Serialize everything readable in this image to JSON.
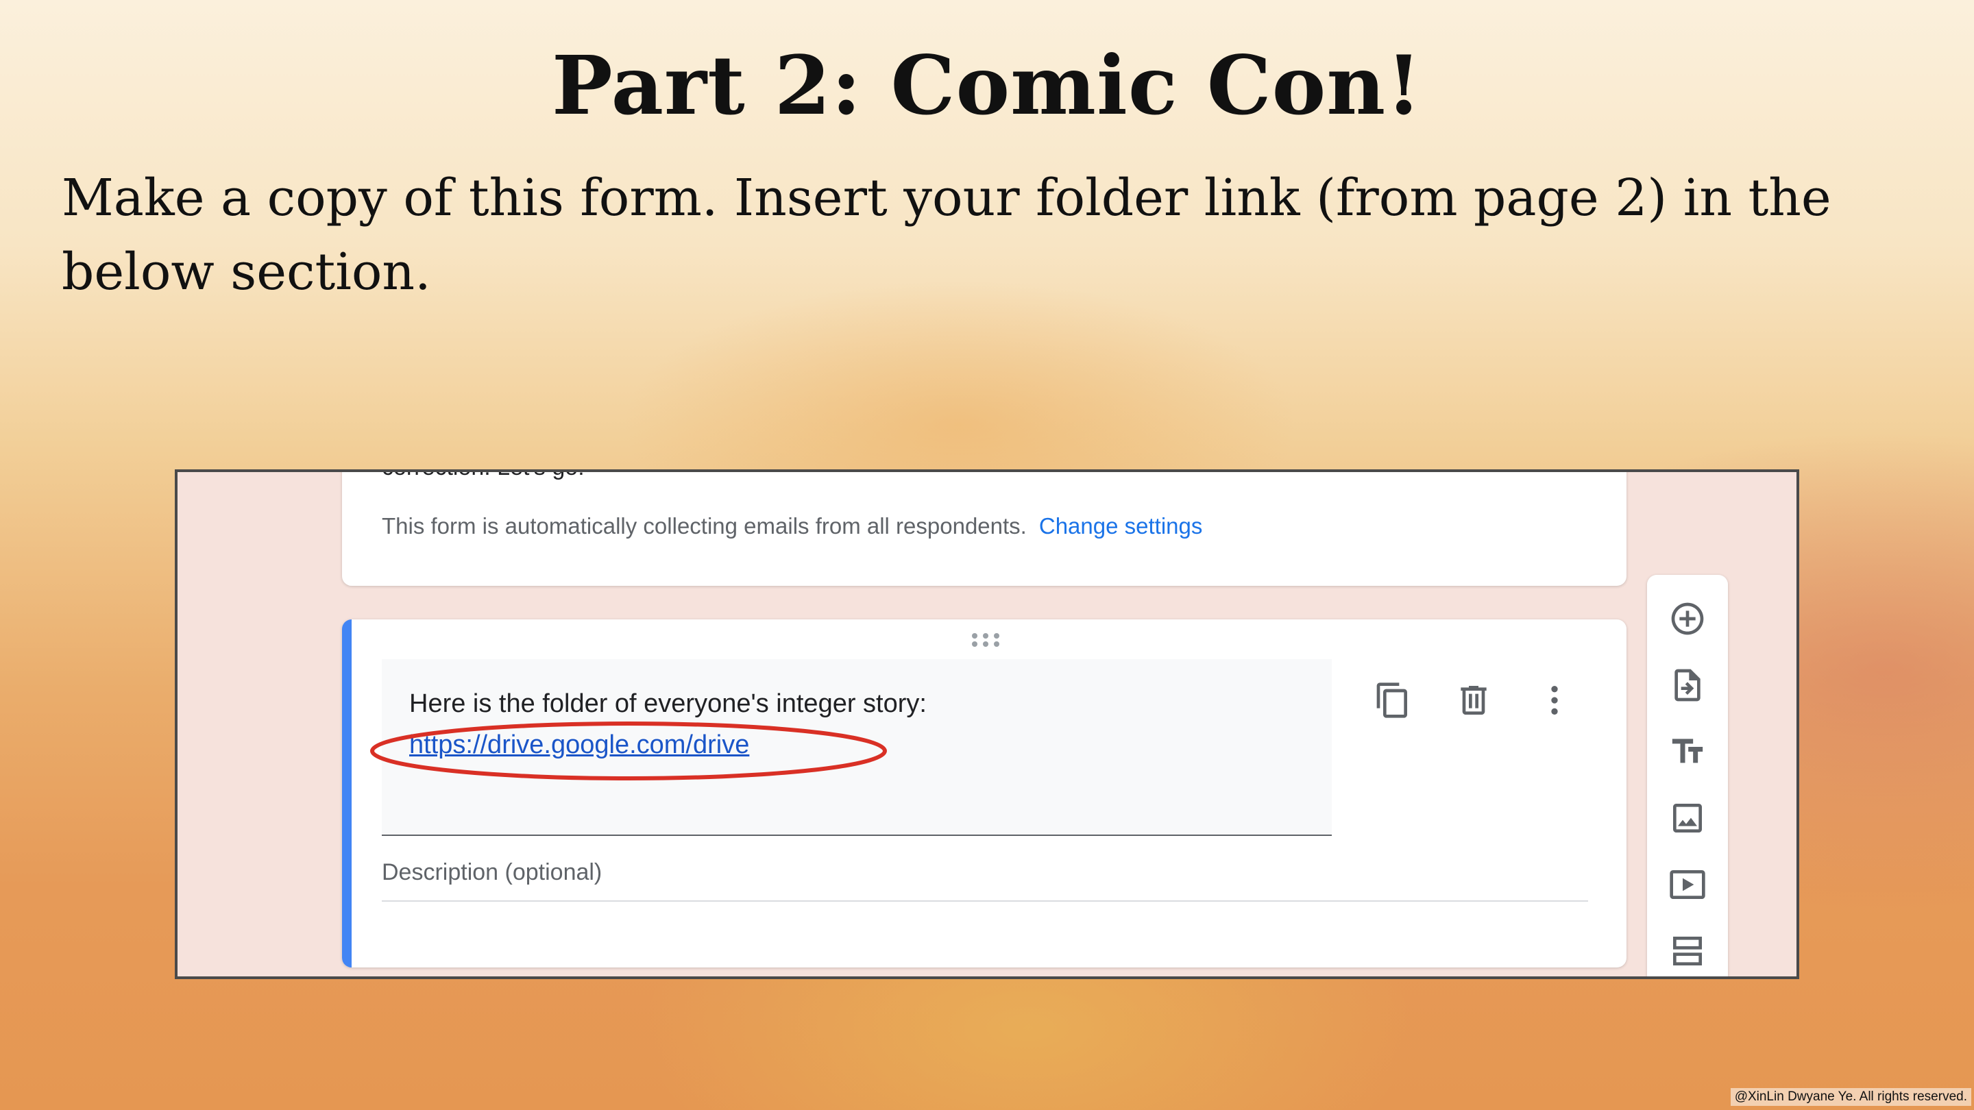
{
  "slide": {
    "title": "Part 2: Comic Con!",
    "instructions": "Make a copy of this form. Insert your folder link (from page 2) in the below section.",
    "copyright": "@XinLin Dwyane Ye. All rights reserved."
  },
  "form": {
    "cut_off_text": "correction. Let's go!",
    "email_notice": "This form is automatically collecting emails from all respondents.",
    "change_settings_link": "Change settings",
    "question_text": "Here is the folder of everyone's integer story:",
    "question_link": "https://drive.google.com/drive",
    "description_placeholder": "Description (optional)"
  },
  "card_tools": [
    "duplicate-icon",
    "delete-icon",
    "more-vert-icon"
  ],
  "side_toolbar": [
    "add-question-icon",
    "import-questions-icon",
    "add-title-icon",
    "add-image-icon",
    "add-video-icon",
    "add-section-icon"
  ],
  "colors": {
    "accent": "#4285f4",
    "link": "#1a73e8",
    "highlight": "#d93025"
  }
}
